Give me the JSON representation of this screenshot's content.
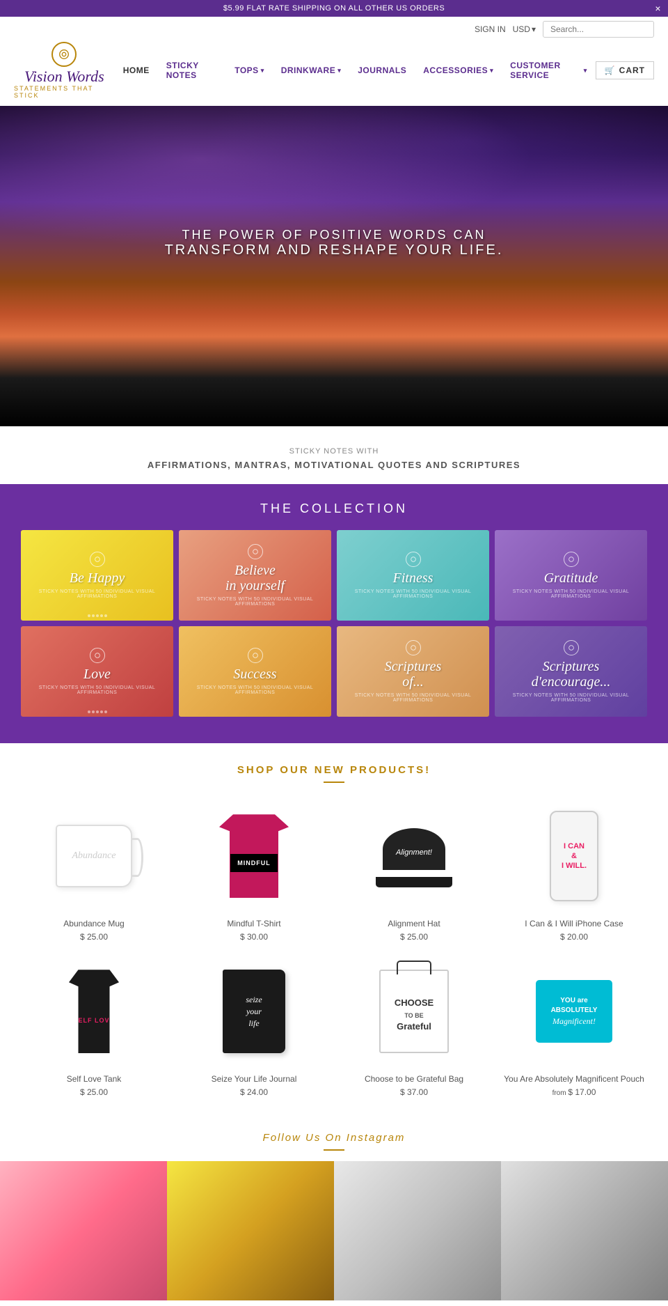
{
  "announcement": {
    "text": "$5.99 FLAT RATE SHIPPING ON ALL OTHER US ORDERS",
    "close_label": "×"
  },
  "header": {
    "sign_in": "SIGN IN",
    "currency": "USD",
    "search_placeholder": "Search...",
    "logo_text": "Vision Words",
    "logo_tagline": "STATEMENTS THAT STICK",
    "cart_label": "CART"
  },
  "nav": {
    "items": [
      {
        "label": "HOME",
        "active": true,
        "has_dropdown": false
      },
      {
        "label": "STICKY NOTES",
        "active": false,
        "has_dropdown": false
      },
      {
        "label": "TOPS",
        "active": false,
        "has_dropdown": true
      },
      {
        "label": "DRINKWARE",
        "active": false,
        "has_dropdown": true
      },
      {
        "label": "JOURNALS",
        "active": false,
        "has_dropdown": false
      },
      {
        "label": "ACCESSORIES",
        "active": false,
        "has_dropdown": true
      },
      {
        "label": "CUSTOMER SERVICE",
        "active": false,
        "has_dropdown": true
      }
    ]
  },
  "hero": {
    "line1": "THE POWER OF POSITIVE WORDS CAN",
    "line2_pre": "",
    "line2": "TRANSFORM AND RESHAPE YOUR LIFE.",
    "transform_highlight": "TRANSFORM",
    "reshape_highlight": "RESHAPE"
  },
  "sticky_notes_section": {
    "sub_label": "STICKY NOTES WITH",
    "main_label": "AFFIRMATIONS, MANTRAS, MOTIVATIONAL QUOTES AND SCRIPTURES"
  },
  "collection": {
    "title": "THE COLLECTION",
    "cards_row1": [
      {
        "label": "Be Happy",
        "sub": "STICKY NOTES WITH 50 INDIVIDUAL VISUAL AFFIRMATIONS"
      },
      {
        "label": "Believe\nin yourself",
        "sub": "STICKY NOTES WITH 50 INDIVIDUAL VISUAL AFFIRMATIONS"
      },
      {
        "label": "Fitness",
        "sub": "STICKY NOTES WITH 50 INDIVIDUAL VISUAL AFFIRMATIONS"
      },
      {
        "label": "Gratitude",
        "sub": "STICKY NOTES WITH 50 INDIVIDUAL VISUAL AFFIRMATIONS"
      }
    ],
    "cards_row2": [
      {
        "label": "Love",
        "sub": "STICKY NOTES WITH 50 INDIVIDUAL VISUAL AFFIRMATIONS"
      },
      {
        "label": "Success",
        "sub": "STICKY NOTES WITH 50 INDIVIDUAL VISUAL AFFIRMATIONS"
      },
      {
        "label": "Scriptures\nof...",
        "sub": "STICKY NOTES WITH 50 INDIVIDUAL VISUAL AFFIRMATIONS"
      },
      {
        "label": "Scriptures\nd'encouragement",
        "sub": "STICKY NOTES WITH 50 INDIVIDUAL VISUAL AFFIRMATIONS"
      }
    ]
  },
  "shop": {
    "title": "SHOP OUR NEW PRODUCTS!",
    "products": [
      {
        "name": "Abundance Mug",
        "price": "$ 25.00",
        "from": false
      },
      {
        "name": "Mindful T-Shirt",
        "price": "$ 30.00",
        "from": false
      },
      {
        "name": "Alignment Hat",
        "price": "$ 25.00",
        "from": false
      },
      {
        "name": "I Can & I Will iPhone Case",
        "price": "$ 20.00",
        "from": false
      },
      {
        "name": "Self Love Tank",
        "price": "$ 25.00",
        "from": false
      },
      {
        "name": "Seize Your Life Journal",
        "price": "$ 24.00",
        "from": false
      },
      {
        "name": "Choose to be Grateful Bag",
        "price": "$ 37.00",
        "from": false
      },
      {
        "name": "You Are Absolutely Magnificent Pouch",
        "price": "$ 17.00",
        "from": true
      }
    ]
  },
  "instagram": {
    "title": "Follow Us On Instagram"
  }
}
